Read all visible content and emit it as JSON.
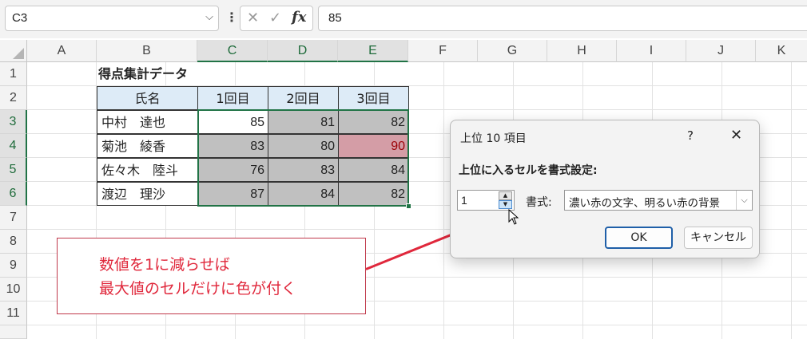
{
  "formula_bar": {
    "name_box": "C3",
    "cancel_glyph": "✕",
    "enter_glyph": "✓",
    "fx_label": "fx",
    "formula_value": "85"
  },
  "columns": [
    "A",
    "B",
    "C",
    "D",
    "E",
    "F",
    "G",
    "H",
    "I",
    "J",
    "K"
  ],
  "rows": [
    "1",
    "2",
    "3",
    "4",
    "5",
    "6",
    "7",
    "8",
    "9",
    "10",
    "11"
  ],
  "sheet": {
    "title": "得点集計データ",
    "headers": [
      "氏名",
      "1回目",
      "2回目",
      "3回目"
    ],
    "records": [
      {
        "name": "中村　達也",
        "scores": [
          "85",
          "81",
          "82"
        ]
      },
      {
        "name": "菊池　綾香",
        "scores": [
          "83",
          "80",
          "90"
        ]
      },
      {
        "name": "佐々木　陸斗",
        "scores": [
          "76",
          "83",
          "84"
        ]
      },
      {
        "name": "渡辺　理沙",
        "scores": [
          "87",
          "84",
          "82"
        ]
      }
    ]
  },
  "callout": {
    "line1": "数値を1に減らせば",
    "line2": "最大値のセルだけに色が付く"
  },
  "dialog": {
    "title": "上位 10 項目",
    "help": "?",
    "close": "✕",
    "label": "上位に入るセルを書式設定:",
    "rank_value": "1",
    "format_label": "書式:",
    "format_value": "濃い赤の文字、明るい赤の背景",
    "ok": "OK",
    "cancel": "キャンセル"
  },
  "colors": {
    "selection_green": "#217346",
    "highlight_fill": "#d49da6",
    "highlight_text": "#9c0006",
    "gray_fill": "#c0c0c0",
    "header_fill": "#ddebf7",
    "callout_red": "#e0283c"
  }
}
